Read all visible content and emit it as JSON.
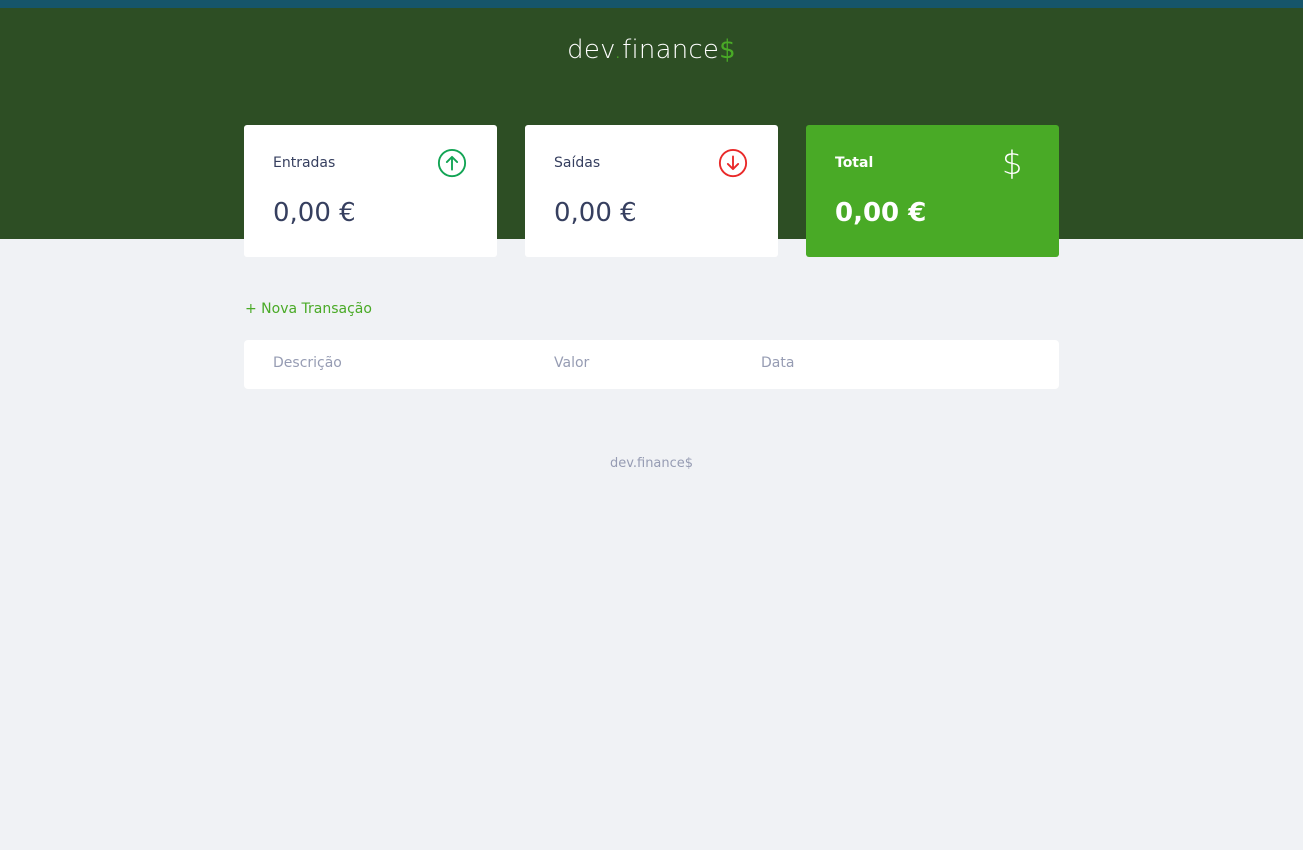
{
  "header": {
    "logo_main": "dev",
    "logo_dot": ".",
    "logo_rest": "finance",
    "logo_dollar": "$"
  },
  "cards": {
    "income": {
      "label": "Entradas",
      "value": "0,00 €",
      "icon": "arrow-up-circle-icon",
      "icon_color": "#12a454"
    },
    "expense": {
      "label": "Saídas",
      "value": "0,00 €",
      "icon": "arrow-down-circle-icon",
      "icon_color": "#e92929"
    },
    "total": {
      "label": "Total",
      "value": "0,00 €",
      "icon": "dollar-icon",
      "icon_glyph": "$",
      "background": "#49aa26"
    }
  },
  "actions": {
    "new_transaction": "+ Nova Transação"
  },
  "table": {
    "columns": [
      "Descrição",
      "Valor",
      "Data"
    ],
    "rows": []
  },
  "footer": {
    "text": "dev.finance$"
  },
  "colors": {
    "header_bg": "#2d4e24",
    "top_strip": "#16556a",
    "accent": "#49aa26",
    "page_bg": "#f0f2f5",
    "text_dark": "#363f5f",
    "text_muted": "#969cb3"
  }
}
